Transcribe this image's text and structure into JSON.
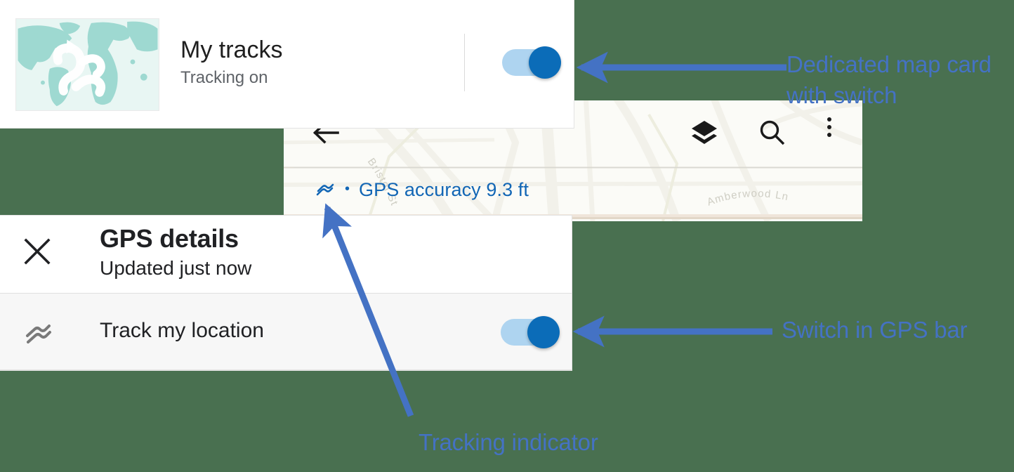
{
  "background_color": "#497050",
  "accent_color": "#4472c4",
  "toggle_on_color": "#0b6cb8",
  "toggle_track_color": "#aed4f0",
  "link_color": "#1266b5",
  "tracks_card": {
    "title": "My tracks",
    "subtitle": "Tracking on",
    "thumbnail_icon": "track-squiggle-map-icon",
    "toggle": {
      "name": "tracking-toggle",
      "state": "on"
    }
  },
  "map_panel": {
    "toolbar": {
      "back_icon": "back-arrow-icon",
      "layers_icon": "layers-icon",
      "search_icon": "search-icon",
      "more_icon": "more-vert-icon"
    },
    "street_labels": [
      "Bristol St",
      "Amberwood Ln"
    ],
    "gps_bar": {
      "icon": "track-squiggle-icon",
      "bullet": "•",
      "text": "GPS accuracy 9.3 ft"
    }
  },
  "gps_details": {
    "close_icon": "close-icon",
    "title": "GPS details",
    "subtitle": "Updated just now",
    "rows": [
      {
        "icon": "track-squiggle-icon",
        "label": "Track my location",
        "toggle": {
          "name": "track-my-location-toggle",
          "state": "on"
        }
      }
    ]
  },
  "annotations": [
    {
      "id": "map-card",
      "text": "Dedicated map card\nwith switch"
    },
    {
      "id": "gps-switch",
      "text": "Switch in GPS bar"
    },
    {
      "id": "tracking",
      "text": "Tracking indicator"
    }
  ]
}
